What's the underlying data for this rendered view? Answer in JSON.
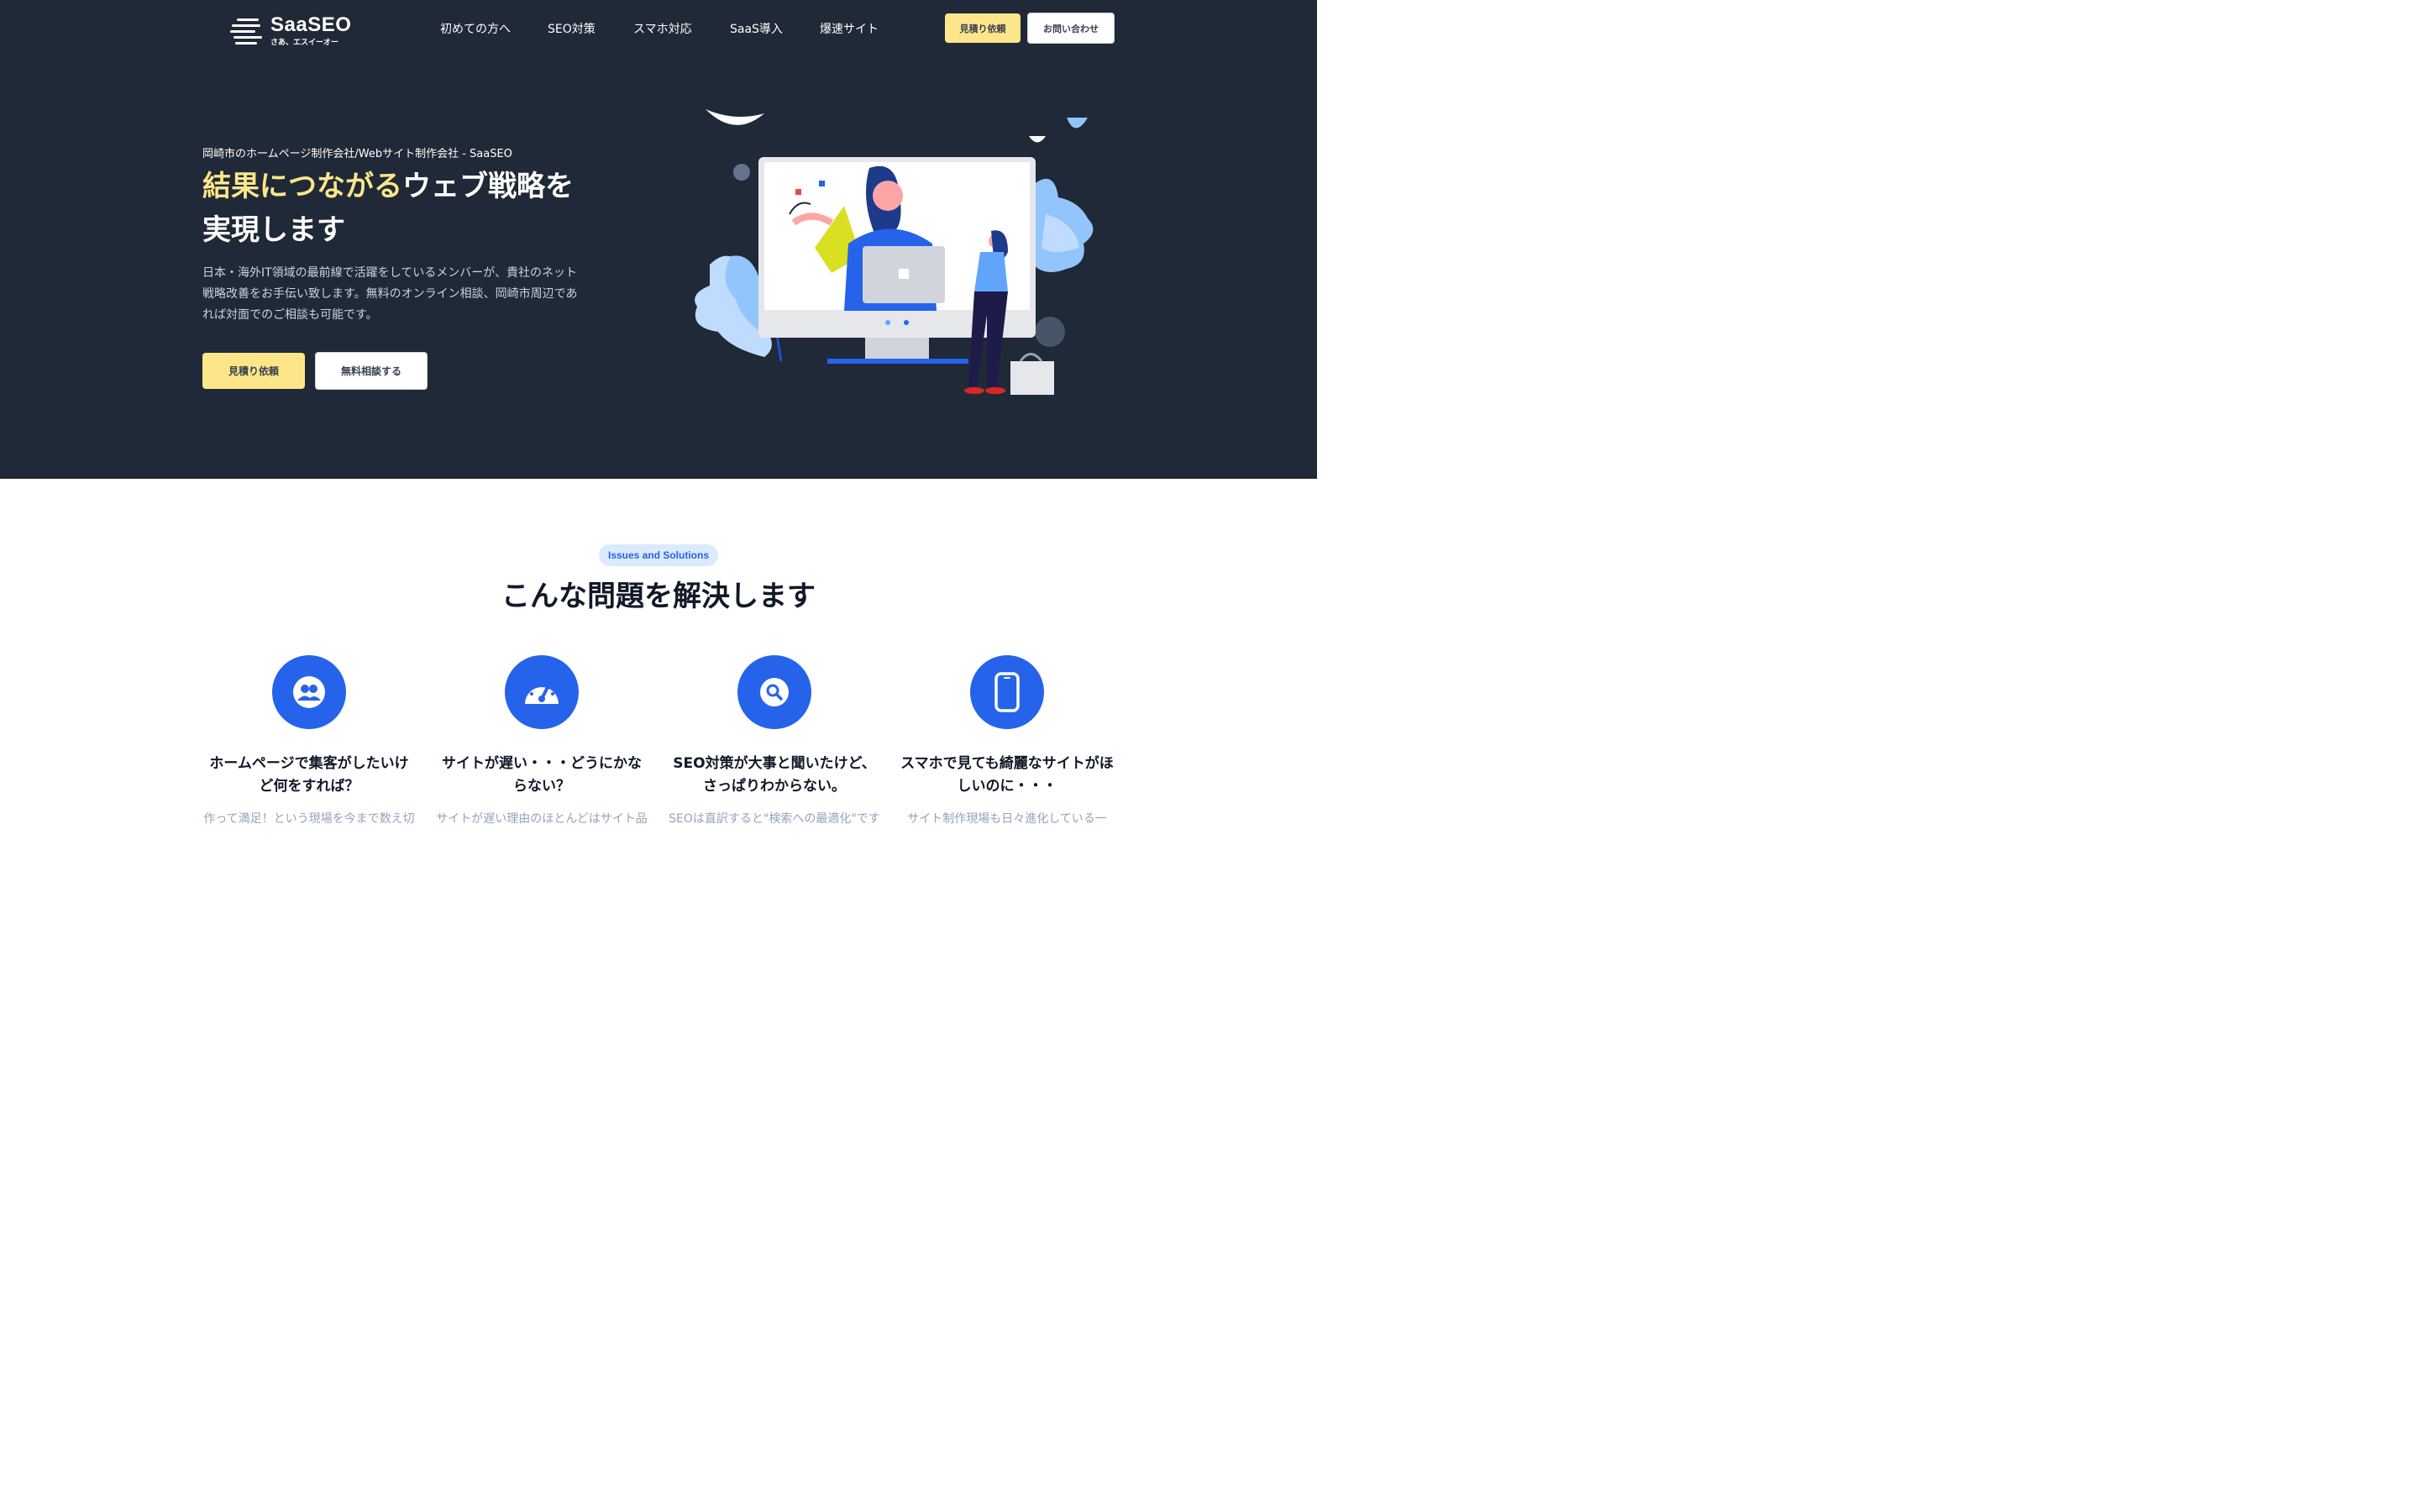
{
  "header": {
    "logo_name": "SaaSEO",
    "logo_tagline": "さあ、エスイーオー",
    "nav": [
      "初めての方へ",
      "SEO対策",
      "スマホ対応",
      "SaaS導入",
      "爆速サイト"
    ],
    "quote_button": "見積り依頼",
    "contact_button": "お問い合わせ"
  },
  "hero": {
    "kicker": "岡崎市のホームページ制作会社/Webサイト制作会社 - SaaSEO",
    "title_highlight": "結果につながる",
    "title_rest": "ウェブ戦略を実現します",
    "description": "日本・海外IT領域の最前線で活躍をしているメンバーが、貴社のネット戦略改善をお手伝い致します。無料のオンライン相談、岡崎市周辺であれば対面でのご相談も可能です。",
    "primary_button": "見積り依頼",
    "secondary_button": "無料相談する"
  },
  "issues": {
    "badge": "Issues and Solutions",
    "title": "こんな問題を解決します",
    "items": [
      {
        "icon": "users-icon",
        "title": "ホームページで集客がしたいけど何をすれば？",
        "text": "作って満足！という現場を今まで数え切"
      },
      {
        "icon": "speedometer-icon",
        "title": "サイトが遅い・・・どうにかならない？",
        "text": "サイトが遅い理由のほとんどはサイト品"
      },
      {
        "icon": "search-icon",
        "title": "SEO対策が大事と聞いたけど、さっぱりわからない。",
        "text": "SEOは直訳すると\"検索への最適化\"です"
      },
      {
        "icon": "smartphone-icon",
        "title": "スマホで見ても綺麗なサイトがほしいのに・・・",
        "text": "サイト制作現場も日々進化している一"
      }
    ]
  },
  "colors": {
    "hero_bg": "#1f2937",
    "accent_yellow": "#fde68a",
    "brand_blue": "#2563eb",
    "badge_bg": "#dbeafe"
  }
}
